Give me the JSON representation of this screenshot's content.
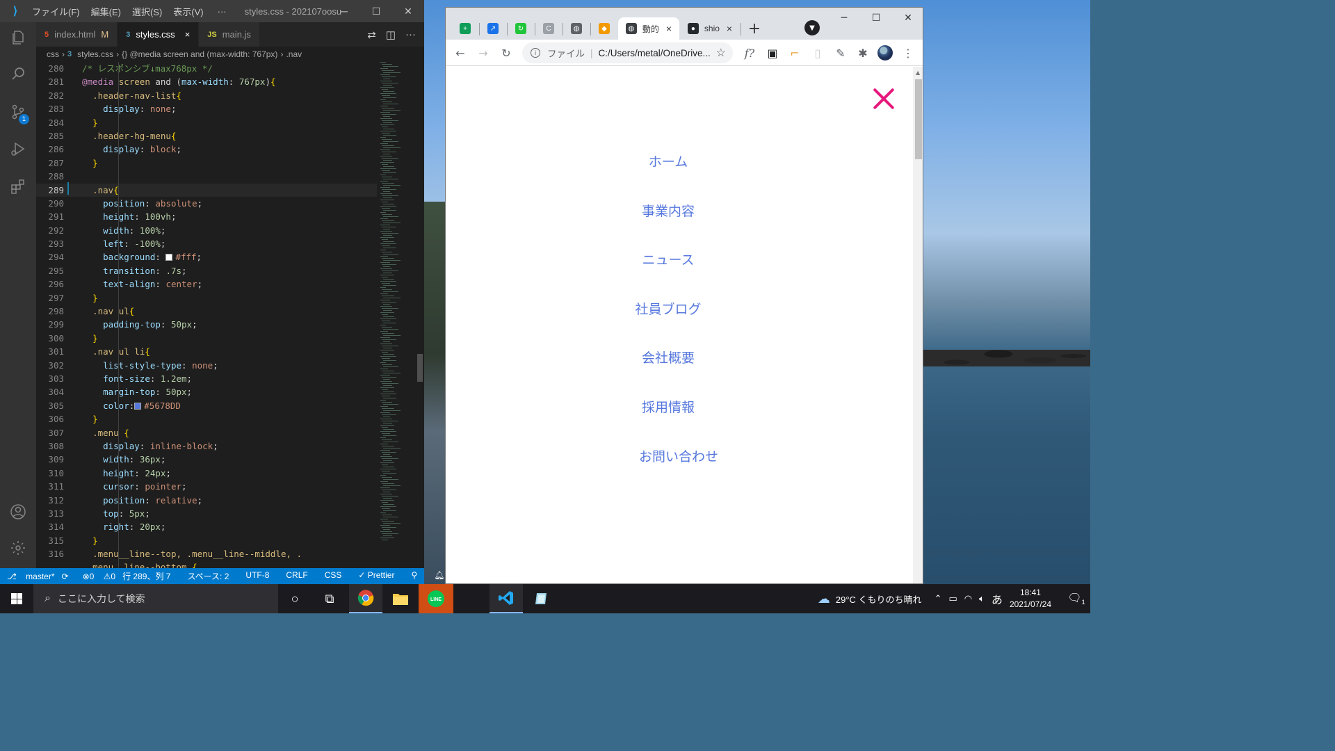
{
  "vscode": {
    "menu": [
      "ファイル(F)",
      "編集(E)",
      "選択(S)",
      "表示(V)"
    ],
    "more": "···",
    "window_title": "styles.css - 202107oosu...",
    "tabs": [
      {
        "label": "index.html",
        "modified": "M",
        "type": "html",
        "icon": "5"
      },
      {
        "label": "styles.css",
        "close": "×",
        "type": "css",
        "icon": "3"
      },
      {
        "label": "main.js",
        "type": "js",
        "icon": "JS"
      }
    ],
    "breadcrumb": [
      "css",
      "styles.css",
      "{} @media screen and (max-width: 767px)",
      ".nav"
    ],
    "scm_badge": "1",
    "current_line": 289,
    "lines": [
      {
        "n": 280,
        "t": [
          [
            "c-comment",
            "/* レスポンシブ↓max768px */"
          ]
        ]
      },
      {
        "n": 281,
        "t": [
          [
            "c-at",
            "@media"
          ],
          [
            "c-plain",
            " "
          ],
          [
            "c-sel",
            "screen"
          ],
          [
            "c-plain",
            " and "
          ],
          [
            "c-plain",
            "("
          ],
          [
            "c-prop",
            "max-width"
          ],
          [
            "c-plain",
            ": "
          ],
          [
            "c-num",
            "767px"
          ],
          [
            "c-plain",
            ")"
          ],
          [
            "c-punc",
            "{"
          ]
        ]
      },
      {
        "n": 282,
        "t": [
          [
            "c-plain",
            "  "
          ],
          [
            "c-sel",
            ".header-nav-list"
          ],
          [
            "c-punc",
            "{"
          ]
        ]
      },
      {
        "n": 283,
        "t": [
          [
            "c-plain",
            "    "
          ],
          [
            "c-prop",
            "display"
          ],
          [
            "c-plain",
            ": "
          ],
          [
            "c-val",
            "none"
          ],
          [
            "c-plain",
            ";"
          ]
        ]
      },
      {
        "n": 284,
        "t": [
          [
            "c-plain",
            "  "
          ],
          [
            "c-punc",
            "}"
          ]
        ]
      },
      {
        "n": 285,
        "t": [
          [
            "c-plain",
            "  "
          ],
          [
            "c-sel",
            ".header-hg-menu"
          ],
          [
            "c-punc",
            "{"
          ]
        ]
      },
      {
        "n": 286,
        "t": [
          [
            "c-plain",
            "    "
          ],
          [
            "c-prop",
            "display"
          ],
          [
            "c-plain",
            ": "
          ],
          [
            "c-val",
            "block"
          ],
          [
            "c-plain",
            ";"
          ]
        ]
      },
      {
        "n": 287,
        "t": [
          [
            "c-plain",
            "  "
          ],
          [
            "c-punc",
            "}"
          ]
        ]
      },
      {
        "n": 288,
        "t": [
          [
            "c-plain",
            ""
          ]
        ]
      },
      {
        "n": 289,
        "t": [
          [
            "c-plain",
            "  "
          ],
          [
            "c-sel",
            ".nav"
          ],
          [
            "c-punc",
            "{"
          ]
        ]
      },
      {
        "n": 290,
        "t": [
          [
            "c-plain",
            "    "
          ],
          [
            "c-prop",
            "position"
          ],
          [
            "c-plain",
            ": "
          ],
          [
            "c-val",
            "absolute"
          ],
          [
            "c-plain",
            ";"
          ]
        ]
      },
      {
        "n": 291,
        "t": [
          [
            "c-plain",
            "    "
          ],
          [
            "c-prop",
            "height"
          ],
          [
            "c-plain",
            ": "
          ],
          [
            "c-num",
            "100vh"
          ],
          [
            "c-plain",
            ";"
          ]
        ]
      },
      {
        "n": 292,
        "t": [
          [
            "c-plain",
            "    "
          ],
          [
            "c-prop",
            "width"
          ],
          [
            "c-plain",
            ": "
          ],
          [
            "c-num",
            "100%"
          ],
          [
            "c-plain",
            ";"
          ]
        ]
      },
      {
        "n": 293,
        "t": [
          [
            "c-plain",
            "    "
          ],
          [
            "c-prop",
            "left"
          ],
          [
            "c-plain",
            ": "
          ],
          [
            "c-num",
            "-100%"
          ],
          [
            "c-plain",
            ";"
          ]
        ]
      },
      {
        "n": 294,
        "t": [
          [
            "c-plain",
            "    "
          ],
          [
            "c-prop",
            "background"
          ],
          [
            "c-plain",
            ": "
          ],
          [
            "swatch:#ffffff",
            ""
          ],
          [
            "c-val",
            "#fff"
          ],
          [
            "c-plain",
            ";"
          ]
        ]
      },
      {
        "n": 295,
        "t": [
          [
            "c-plain",
            "    "
          ],
          [
            "c-prop",
            "transition"
          ],
          [
            "c-plain",
            ": "
          ],
          [
            "c-num",
            ".7s"
          ],
          [
            "c-plain",
            ";"
          ]
        ]
      },
      {
        "n": 296,
        "t": [
          [
            "c-plain",
            "    "
          ],
          [
            "c-prop",
            "text-align"
          ],
          [
            "c-plain",
            ": "
          ],
          [
            "c-val",
            "center"
          ],
          [
            "c-plain",
            ";"
          ]
        ]
      },
      {
        "n": 297,
        "t": [
          [
            "c-plain",
            "  "
          ],
          [
            "c-punc",
            "}"
          ]
        ]
      },
      {
        "n": 298,
        "t": [
          [
            "c-plain",
            "  "
          ],
          [
            "c-sel",
            ".nav ul"
          ],
          [
            "c-punc",
            "{"
          ]
        ]
      },
      {
        "n": 299,
        "t": [
          [
            "c-plain",
            "    "
          ],
          [
            "c-prop",
            "padding-top"
          ],
          [
            "c-plain",
            ": "
          ],
          [
            "c-num",
            "50px"
          ],
          [
            "c-plain",
            ";"
          ]
        ]
      },
      {
        "n": 300,
        "t": [
          [
            "c-plain",
            "  "
          ],
          [
            "c-punc",
            "}"
          ]
        ]
      },
      {
        "n": 301,
        "t": [
          [
            "c-plain",
            "  "
          ],
          [
            "c-sel",
            ".nav ul li"
          ],
          [
            "c-punc",
            "{"
          ]
        ]
      },
      {
        "n": 302,
        "t": [
          [
            "c-plain",
            "    "
          ],
          [
            "c-prop",
            "list-style-type"
          ],
          [
            "c-plain",
            ": "
          ],
          [
            "c-val",
            "none"
          ],
          [
            "c-plain",
            ";"
          ]
        ]
      },
      {
        "n": 303,
        "t": [
          [
            "c-plain",
            "    "
          ],
          [
            "c-prop",
            "font-size"
          ],
          [
            "c-plain",
            ": "
          ],
          [
            "c-num",
            "1.2em"
          ],
          [
            "c-plain",
            ";"
          ]
        ]
      },
      {
        "n": 304,
        "t": [
          [
            "c-plain",
            "    "
          ],
          [
            "c-prop",
            "margin-top"
          ],
          [
            "c-plain",
            ": "
          ],
          [
            "c-num",
            "50px"
          ],
          [
            "c-plain",
            ";"
          ]
        ]
      },
      {
        "n": 305,
        "t": [
          [
            "c-plain",
            "    "
          ],
          [
            "c-prop",
            "color"
          ],
          [
            "c-plain",
            ":"
          ],
          [
            "swatch:#5678DD",
            ""
          ],
          [
            "c-val",
            "#5678DD"
          ]
        ]
      },
      {
        "n": 306,
        "t": [
          [
            "c-plain",
            "  "
          ],
          [
            "c-punc",
            "}"
          ]
        ]
      },
      {
        "n": 307,
        "t": [
          [
            "c-plain",
            "  "
          ],
          [
            "c-sel",
            ".menu"
          ],
          [
            "c-plain",
            " "
          ],
          [
            "c-punc",
            "{"
          ]
        ]
      },
      {
        "n": 308,
        "t": [
          [
            "c-plain",
            "    "
          ],
          [
            "c-prop",
            "display"
          ],
          [
            "c-plain",
            ": "
          ],
          [
            "c-val",
            "inline-block"
          ],
          [
            "c-plain",
            ";"
          ]
        ]
      },
      {
        "n": 309,
        "t": [
          [
            "c-plain",
            "    "
          ],
          [
            "c-prop",
            "width"
          ],
          [
            "c-plain",
            ": "
          ],
          [
            "c-num",
            "36px"
          ],
          [
            "c-plain",
            ";"
          ]
        ]
      },
      {
        "n": 310,
        "t": [
          [
            "c-plain",
            "    "
          ],
          [
            "c-prop",
            "height"
          ],
          [
            "c-plain",
            ": "
          ],
          [
            "c-num",
            "24px"
          ],
          [
            "c-plain",
            ";"
          ]
        ]
      },
      {
        "n": 311,
        "t": [
          [
            "c-plain",
            "    "
          ],
          [
            "c-prop",
            "cursor"
          ],
          [
            "c-plain",
            ": "
          ],
          [
            "c-val",
            "pointer"
          ],
          [
            "c-plain",
            ";"
          ]
        ]
      },
      {
        "n": 312,
        "t": [
          [
            "c-plain",
            "    "
          ],
          [
            "c-prop",
            "position"
          ],
          [
            "c-plain",
            ": "
          ],
          [
            "c-val",
            "relative"
          ],
          [
            "c-plain",
            ";"
          ]
        ]
      },
      {
        "n": 313,
        "t": [
          [
            "c-plain",
            "    "
          ],
          [
            "c-prop",
            "top"
          ],
          [
            "c-plain",
            ": "
          ],
          [
            "c-num",
            "5px"
          ],
          [
            "c-plain",
            ";"
          ]
        ]
      },
      {
        "n": 314,
        "t": [
          [
            "c-plain",
            "    "
          ],
          [
            "c-prop",
            "right"
          ],
          [
            "c-plain",
            ": "
          ],
          [
            "c-num",
            "20px"
          ],
          [
            "c-plain",
            ";"
          ]
        ]
      },
      {
        "n": 315,
        "t": [
          [
            "c-plain",
            "  "
          ],
          [
            "c-punc",
            "}"
          ]
        ]
      },
      {
        "n": 316,
        "t": [
          [
            "c-plain",
            "  "
          ],
          [
            "c-sel",
            ".menu__line--top, .menu__line--middle, ."
          ]
        ]
      },
      {
        "n": "",
        "t": [
          [
            "c-plain",
            "  "
          ],
          [
            "c-sel",
            "menu__line--bottom"
          ],
          [
            "c-plain",
            " "
          ],
          [
            "c-punc",
            "{"
          ]
        ]
      }
    ],
    "status": {
      "branch": "master*",
      "errors": "⊗0",
      "warnings": "⚠0",
      "position": "行 289、列 7",
      "spaces": "スペース: 2",
      "encoding": "UTF-8",
      "eol": "CRLF",
      "language": "CSS",
      "formatter": "✓ Prettier"
    }
  },
  "chrome": {
    "tabs": [
      {
        "fav": "+",
        "color": "#0f9d58"
      },
      {
        "fav": "↗",
        "color": "#1a73e8"
      },
      {
        "fav": "↻",
        "color": "#21c53a"
      },
      {
        "fav": "C",
        "color": "#9aa0a6"
      },
      {
        "fav": "◍",
        "color": "#5f6368"
      },
      {
        "fav": "◆",
        "color": "#f29900"
      },
      {
        "fav": "◍",
        "color": "#3c4043",
        "label": "動的",
        "active": true,
        "close": "×"
      },
      {
        "fav": "●",
        "color": "#24292e",
        "label": "shio",
        "close": "×"
      }
    ],
    "new_tab": "+",
    "omnibox": {
      "label": "ファイル",
      "url": "C:/Users/metal/OneDrive..."
    },
    "extension_text": "f?"
  },
  "page": {
    "nav_items": [
      "ホーム",
      "事業内容",
      "ニュース",
      "社員ブログ",
      "会社概要",
      "採用情報",
      "お問い合わせ"
    ]
  },
  "taskbar": {
    "search_placeholder": "ここに入力して検索",
    "weather": "29°C  くもりのち晴れ",
    "ime": "あ",
    "time": "18:41",
    "date": "2021/07/24",
    "notification_count": "1"
  }
}
